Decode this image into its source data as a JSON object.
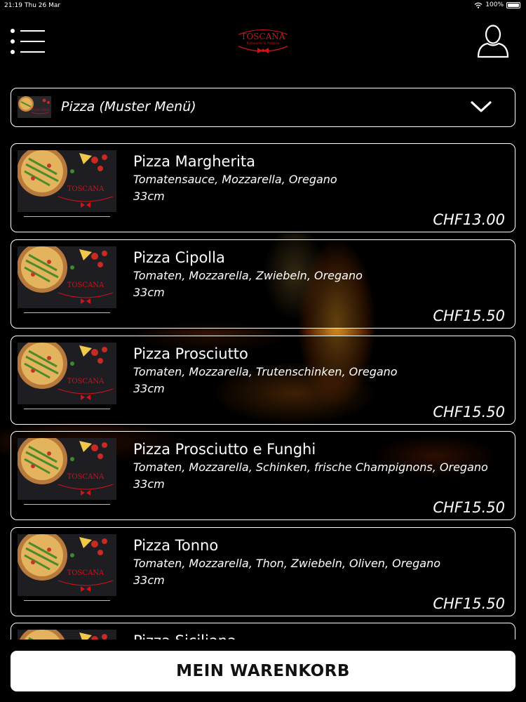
{
  "status_bar": {
    "time": "21:19",
    "date": "Thu 26 Mar",
    "battery": "100%"
  },
  "header": {
    "logo_name": "TOSCANA",
    "logo_sub": "Ristorante & Pizzeria",
    "icons": {
      "menu": "hamburger-menu-icon",
      "profile": "user-profile-icon"
    }
  },
  "category": {
    "label": "Pizza (Muster Menü)",
    "icon": "chevron-down-icon"
  },
  "items": [
    {
      "name": "Pizza Margherita",
      "description": "Tomatensauce, Mozzarella, Oregano",
      "size": "33cm",
      "price": "CHF13.00"
    },
    {
      "name": "Pizza Cipolla",
      "description": "Tomaten, Mozzarella, Zwiebeln, Oregano",
      "size": "33cm",
      "price": "CHF15.50"
    },
    {
      "name": "Pizza Prosciutto",
      "description": "Tomaten, Mozzarella, Trutenschinken, Oregano",
      "size": "33cm",
      "price": "CHF15.50"
    },
    {
      "name": "Pizza Prosciutto e Funghi",
      "description": "Tomaten, Mozzarella, Schinken, frische Champignons, Oregano",
      "size": "33cm",
      "price": "CHF15.50"
    },
    {
      "name": "Pizza Tonno",
      "description": "Tomaten, Mozzarella, Thon, Zwiebeln, Oliven, Oregano",
      "size": "33cm",
      "price": "CHF15.50"
    },
    {
      "name": "Pizza Siciliana",
      "description": "",
      "size": "",
      "price": ""
    }
  ],
  "cart": {
    "label": "MEIN WARENKORB"
  },
  "colors": {
    "background": "#000000",
    "accent_red": "#d0121b",
    "text": "#ffffff",
    "cart_bg": "#ffffff"
  }
}
